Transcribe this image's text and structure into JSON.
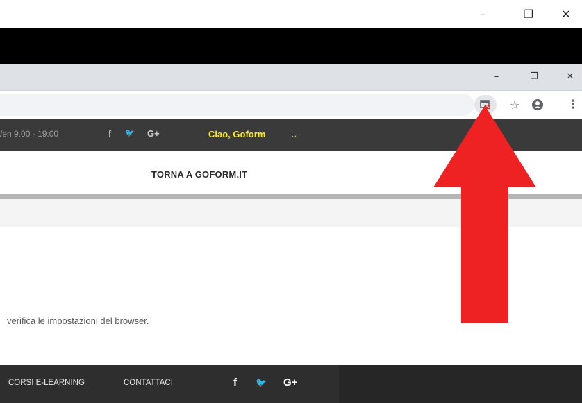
{
  "window": {
    "outer_controls": [
      "–",
      "❐",
      "✕"
    ],
    "inner_controls": [
      "–",
      "❐",
      "✕"
    ]
  },
  "toolbar": {
    "icons": [
      "popup-blocked-icon",
      "star-icon",
      "account-icon",
      "more-menu-icon"
    ],
    "star_glyph": "☆",
    "account_glyph": "●",
    "more_glyph": "⋮"
  },
  "site": {
    "hours": "/en 9.00 - 19.00",
    "social_top": [
      "f",
      "🐦",
      "G+"
    ],
    "greeting": "Ciao, Goform",
    "greeting_arrow": "🡓",
    "back_link": "TORNA A GOFORM.IT",
    "message": "verifica le impostazioni del browser.",
    "footer_links": [
      "CORSI E-LEARNING",
      "CONTATTACI"
    ],
    "social_footer": [
      "f",
      "🐦",
      "G+"
    ]
  },
  "colors": {
    "accent_yellow": "#ffee00",
    "arrow_red": "#ee2222",
    "site_bar": "#3a3a3a",
    "footer": "#2e2e2e"
  }
}
